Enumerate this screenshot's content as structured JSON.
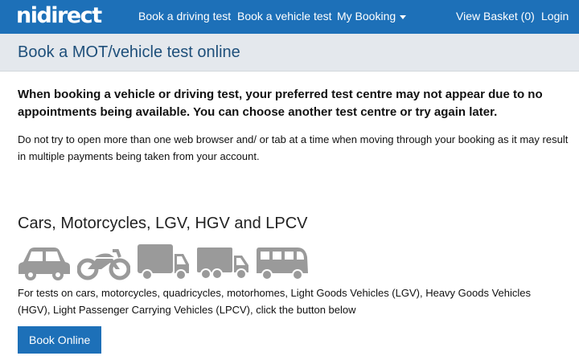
{
  "nav": {
    "logo": "nidirect",
    "links": [
      "Book a driving test",
      "Book a vehicle test",
      "My Booking"
    ],
    "basket": "View Basket (0)",
    "login": "Login"
  },
  "page": {
    "title": "Book a MOT/vehicle test online",
    "alert": "When booking a vehicle or driving test, your preferred test centre may not appear due to no appointments being available. You can choose another test centre or try again later.",
    "note": "Do not try to open more than one web browser and/ or tab at a time when moving through your booking as it may result in multiple payments being taken from your account."
  },
  "section": {
    "heading": "Cars, Motorcycles, LGV, HGV and LPCV",
    "icons": [
      "car-icon",
      "motorcycle-icon",
      "van-icon",
      "lorry-icon",
      "minibus-icon"
    ],
    "description": "For tests on cars, motorcycles, quadricycles, motorhomes, Light Goods Vehicles (LGV), Heavy Goods Vehicles (HGV), Light Passenger Carrying Vehicles (LPCV), click the button below",
    "button": "Book Online"
  },
  "colors": {
    "nav_bg": "#1d70b8",
    "title_bg": "#e4e8ed",
    "title_text": "#1e4f7a",
    "icon_grey": "#9a9a9a"
  }
}
